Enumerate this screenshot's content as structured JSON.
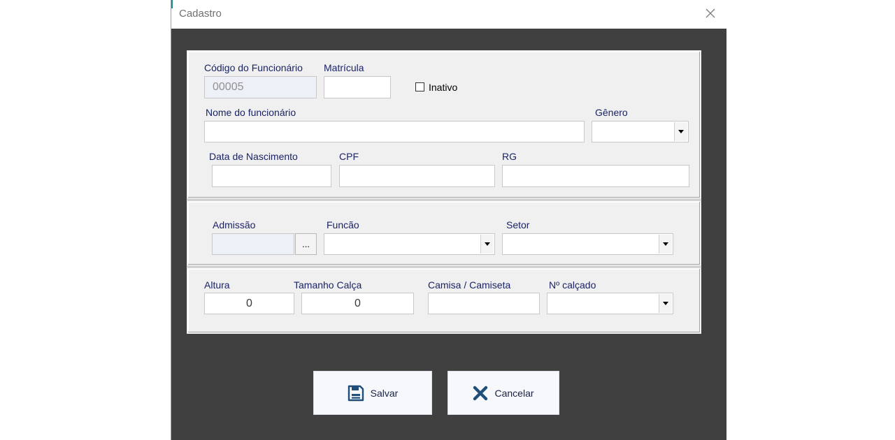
{
  "window": {
    "title": "Cadastro"
  },
  "employee": {
    "code_label": "Código do Funcionário",
    "code_value": "00005",
    "registration_label": "Matrícula",
    "registration_value": "",
    "inactive_label": "Inativo",
    "inactive_checked": false,
    "name_label": "Nome do funcionário",
    "name_value": "",
    "gender_label": "Gênero",
    "gender_value": "",
    "birthdate_label": "Data de Nascimento",
    "birthdate_value": "",
    "cpf_label": "CPF",
    "cpf_value": "",
    "rg_label": "RG",
    "rg_value": ""
  },
  "employment": {
    "admission_label": "Admissão",
    "admission_value": "",
    "admission_picker_label": "...",
    "role_label": "Funcão",
    "role_value": "",
    "sector_label": "Setor",
    "sector_value": ""
  },
  "uniform": {
    "height_label": "Altura",
    "height_value": "0",
    "pants_label": "Tamanho Calça",
    "pants_value": "0",
    "shirt_label": "Camisa / Camiseta",
    "shirt_value": "",
    "shoe_label": "Nº calçado",
    "shoe_value": ""
  },
  "actions": {
    "save_label": "Salvar",
    "cancel_label": "Cancelar"
  },
  "icons": {
    "save": "floppy-disk-icon",
    "cancel": "x-cross-icon",
    "close": "close-icon"
  },
  "colors": {
    "label": "#1a2366",
    "client_bg": "#404040",
    "panel_bg": "#f0f0f0",
    "disabled_field": "#edf1f7",
    "save_icon": "#1f4e79",
    "cancel_icon": "#1f4e79"
  }
}
